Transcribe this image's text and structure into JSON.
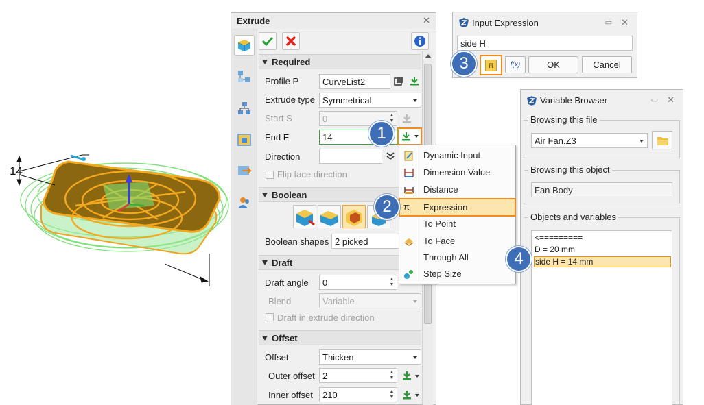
{
  "colors": {
    "accent_orange": "#EF8C1C",
    "highlight_fill": "#FDE6AD",
    "callout_blue": "#3E6FB6",
    "model_brown": "#8B6710",
    "preview_green": "#7FE07A"
  },
  "viewport": {
    "dimension_label": "14"
  },
  "extrude": {
    "title": "Extrude",
    "close_glyph": "✕",
    "required": {
      "header": "Required",
      "profile_label": "Profile P",
      "profile_value": "CurveList2",
      "extrude_type_label": "Extrude type",
      "extrude_type_value": "Symmetrical",
      "start_label": "Start S",
      "start_value": "0",
      "end_label": "End E",
      "end_value": "14",
      "direction_label": "Direction",
      "direction_value": "",
      "flip_label": "Flip face direction"
    },
    "boolean": {
      "header": "Boolean",
      "shapes_label": "Boolean shapes",
      "shapes_value": "2 picked"
    },
    "draft": {
      "header": "Draft",
      "angle_label": "Draft angle",
      "angle_value": "0",
      "blend_label": "Blend",
      "blend_value": "Variable",
      "draft_in_extrude_label": "Draft in extrude direction"
    },
    "offset": {
      "header": "Offset",
      "offset_label": "Offset",
      "offset_value": "Thicken",
      "outer_label": "Outer offset",
      "outer_value": "2",
      "inner_label": "Inner offset",
      "inner_value": "210"
    }
  },
  "menu": {
    "items": [
      {
        "label": "Dynamic Input",
        "icon": "dynamic-input-icon"
      },
      {
        "label": "Dimension Value",
        "icon": "dimension-value-icon"
      },
      {
        "label": "Distance",
        "icon": "distance-icon"
      },
      {
        "label": "Expression",
        "icon": "pi-icon",
        "highlighted": true
      },
      {
        "label": "To Point",
        "icon": ""
      },
      {
        "label": "To Face",
        "icon": "to-face-icon"
      },
      {
        "label": "Through All",
        "icon": ""
      },
      {
        "label": "Step Size",
        "icon": "step-size-icon"
      }
    ]
  },
  "input_expression": {
    "title": "Input Expression",
    "value": "side H",
    "pi_glyph": "π",
    "fx_label": "f(x)",
    "ok_label": "OK",
    "cancel_label": "Cancel"
  },
  "variable_browser": {
    "title": "Variable Browser",
    "browsing_file_label": "Browsing this file",
    "file_value": "Air Fan.Z3",
    "browsing_object_label": "Browsing this object",
    "object_value": "Fan Body",
    "objects_label": "Objects and variables",
    "variables": [
      "<=========",
      "D = 20 mm",
      "side H = 14 mm"
    ],
    "selected_index": 2
  },
  "callouts": [
    "1",
    "2",
    "3",
    "4"
  ]
}
